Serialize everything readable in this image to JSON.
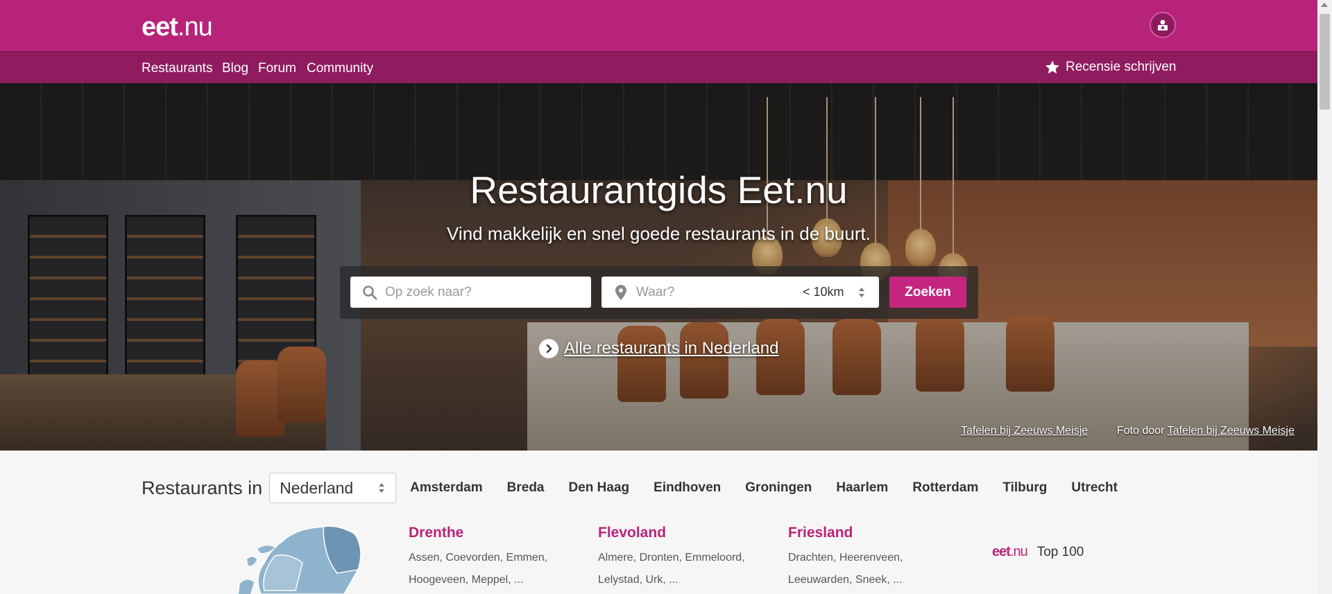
{
  "brand": {
    "logo_bold": "eet",
    "logo_dot": ".nu",
    "accent": "#b8237a"
  },
  "nav": {
    "items": [
      "Restaurants",
      "Blog",
      "Forum",
      "Community"
    ],
    "write_review": "Recensie schrijven"
  },
  "hero": {
    "title": "Restaurantgids Eet.nu",
    "subtitle": "Vind makkelijk en snel goede restaurants in de buurt.",
    "search": {
      "what_placeholder": "Op zoek naar?",
      "where_placeholder": "Waar?",
      "radius": "< 10km",
      "button": "Zoeken"
    },
    "all_link": "Alle restaurants in Nederland",
    "credit_left": "Tafelen bij Zeeuws Meisje",
    "credit_prefix": "Foto door",
    "credit_right": "Tafelen bij Zeeuws Meisje"
  },
  "cities": {
    "label": "Restaurants in",
    "country": "Nederland",
    "items": [
      "Amsterdam",
      "Breda",
      "Den Haag",
      "Eindhoven",
      "Groningen",
      "Haarlem",
      "Rotterdam",
      "Tilburg",
      "Utrecht"
    ]
  },
  "provinces": [
    {
      "name": "Drenthe",
      "towns": "Assen, Coevorden, Emmen, Hoogeveen, Meppel, ..."
    },
    {
      "name": "Flevoland",
      "towns": "Almere, Dronten, Emmeloord, Lelystad, Urk, ..."
    },
    {
      "name": "Friesland",
      "towns": "Drachten, Heerenveen, Leeuwarden, Sneek, ..."
    }
  ],
  "top100": {
    "logo_bold": "eet",
    "logo_dot": ".nu",
    "label": "Top 100"
  },
  "icons": {
    "user": "user-icon",
    "star": "star-icon",
    "search": "search-icon",
    "pin": "location-pin-icon",
    "chevron": "chevron-right-icon",
    "updown": "updown-arrows-icon"
  }
}
